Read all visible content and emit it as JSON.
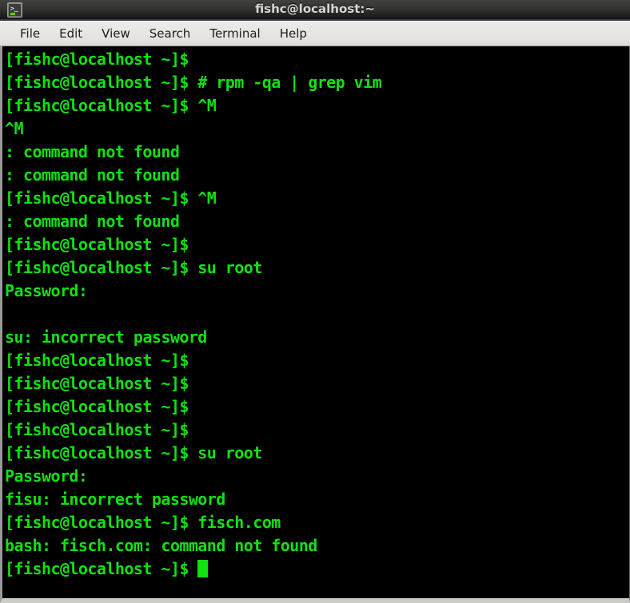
{
  "window": {
    "title": "fishc@localhost:~",
    "icon": "terminal-icon",
    "icon_prompt_glyph": "&gt;_"
  },
  "menubar": {
    "items": [
      {
        "label": "File"
      },
      {
        "label": "Edit"
      },
      {
        "label": "View"
      },
      {
        "label": "Search"
      },
      {
        "label": "Terminal"
      },
      {
        "label": "Help"
      }
    ]
  },
  "terminal": {
    "foreground_color": "#12e012",
    "background_color": "#000000",
    "prompt": "[fishc@localhost ~]$",
    "cursor": "block",
    "lines": [
      "[fishc@localhost ~]$ ",
      "[fishc@localhost ~]$ # rpm -qa | grep vim",
      "[fishc@localhost ~]$ ^M",
      "^M",
      ": command not found",
      ": command not found",
      "[fishc@localhost ~]$ ^M",
      ": command not found",
      "[fishc@localhost ~]$ ",
      "[fishc@localhost ~]$ su root",
      "Password:",
      "",
      "su: incorrect password",
      "[fishc@localhost ~]$ ",
      "[fishc@localhost ~]$ ",
      "[fishc@localhost ~]$ ",
      "[fishc@localhost ~]$ ",
      "[fishc@localhost ~]$ su root",
      "Password:",
      "fisu: incorrect password",
      "[fishc@localhost ~]$ fisch.com",
      "bash: fisch.com: command not found",
      "[fishc@localhost ~]$ "
    ],
    "current_line": "[fishc@localhost ~]$ "
  }
}
